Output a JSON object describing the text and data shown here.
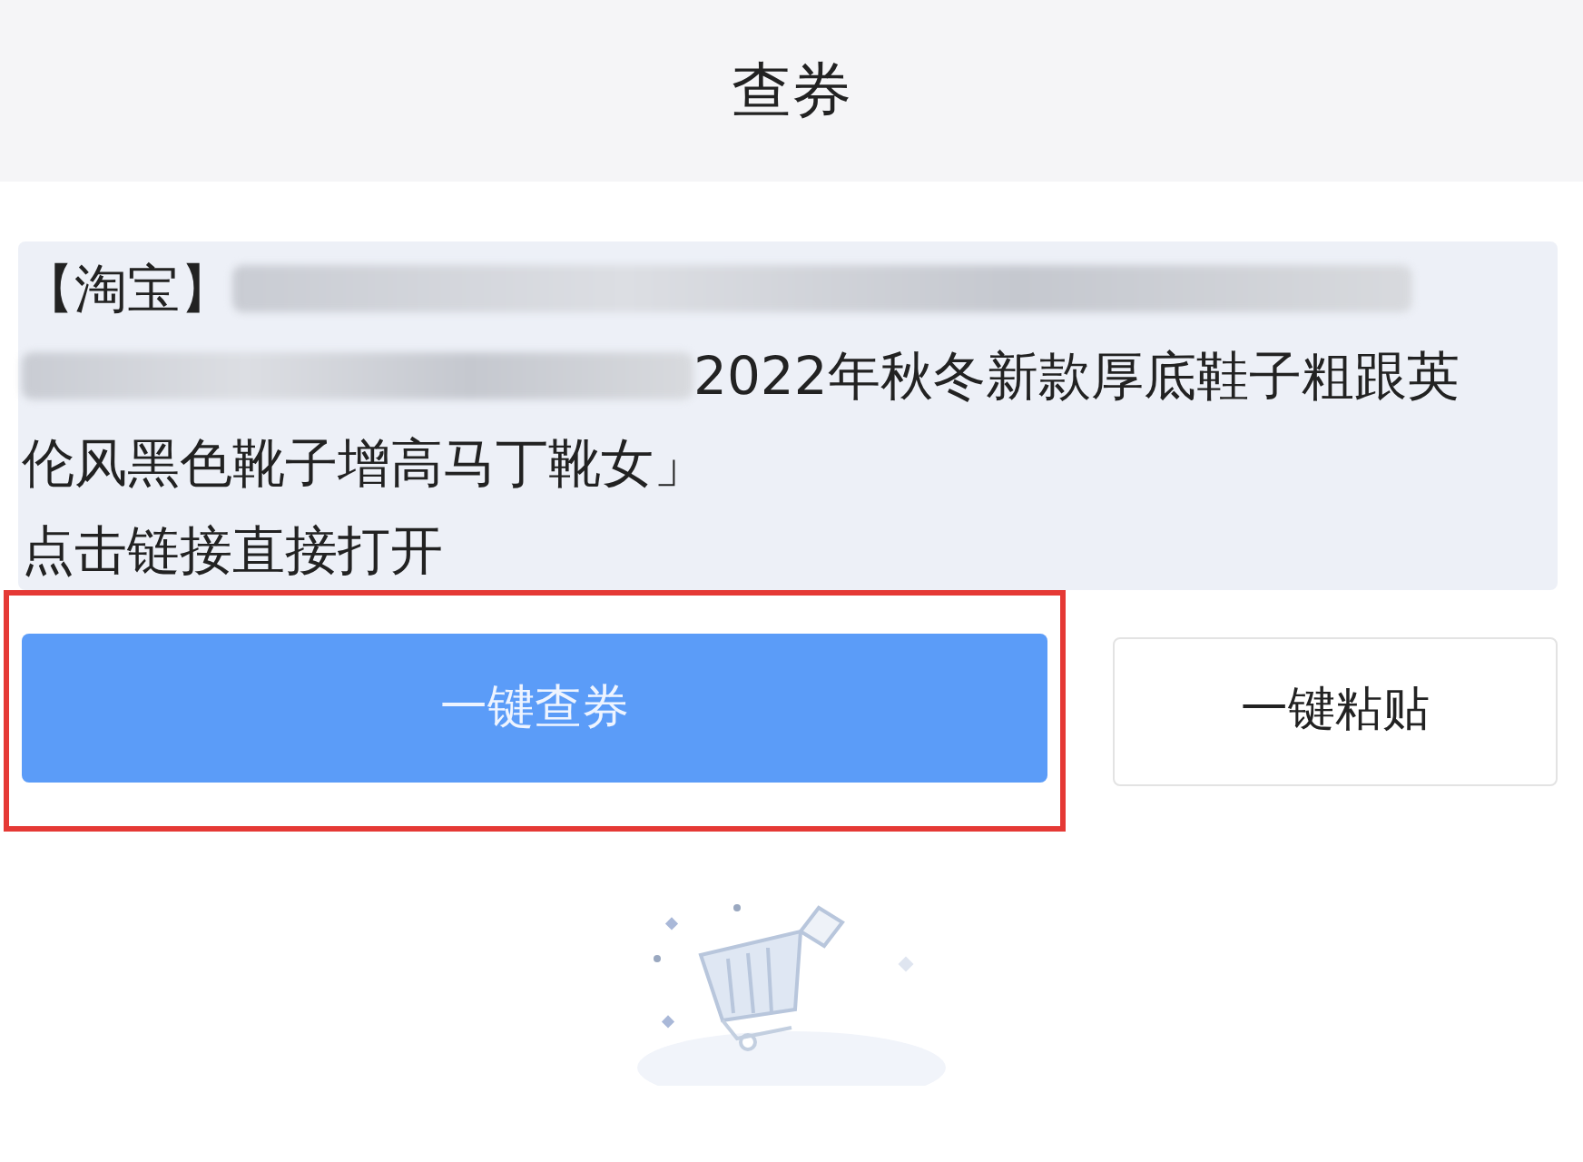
{
  "header": {
    "title": "查券"
  },
  "pasted_text": {
    "lines": [
      {
        "segments": [
          {
            "kind": "text",
            "text": "【淘宝】"
          },
          {
            "kind": "blur"
          }
        ]
      },
      {
        "segments": [
          {
            "kind": "blur"
          },
          {
            "kind": "text",
            "text": "2022年秋冬新款厚底鞋子粗跟英"
          }
        ]
      },
      {
        "segments": [
          {
            "kind": "text",
            "text": "伦风黑色靴子增高马丁靴女」"
          }
        ]
      },
      {
        "segments": [
          {
            "kind": "text",
            "text": "点击链接直接打开"
          }
        ]
      }
    ]
  },
  "buttons": [
    {
      "label": "一键查券",
      "kind": "primary",
      "highlighted": true
    },
    {
      "label": "一键粘贴",
      "kind": "secondary",
      "highlighted": false
    }
  ]
}
